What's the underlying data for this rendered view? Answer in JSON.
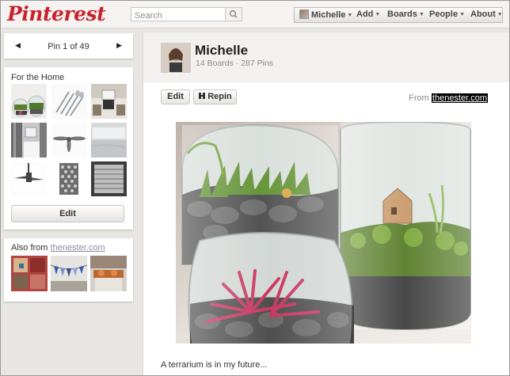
{
  "header": {
    "logo": "Pinterest",
    "search_placeholder": "Search",
    "nav": {
      "user": "Michelle",
      "add": "Add",
      "boards": "Boards",
      "people": "People",
      "about": "About"
    }
  },
  "pager": {
    "label": "Pin 1 of 49"
  },
  "board": {
    "title": "For the Home",
    "edit_label": "Edit"
  },
  "also_from": {
    "prefix": "Also from",
    "source": "thenester.com"
  },
  "profile": {
    "name": "Michelle",
    "stats": "14 Boards · 287 Pins"
  },
  "pin": {
    "edit_label": "Edit",
    "repin_label": "Repin",
    "from_prefix": "From",
    "source": "thenester.com",
    "caption": "A terrarium is in my future..."
  },
  "icons": {
    "prev": "triangle-left",
    "next": "triangle-right",
    "search": "magnifier",
    "repin": "pushpin",
    "caret": "small-down-triangle"
  },
  "colors": {
    "brand": "#c8232c",
    "background": "#e8e6e3"
  }
}
